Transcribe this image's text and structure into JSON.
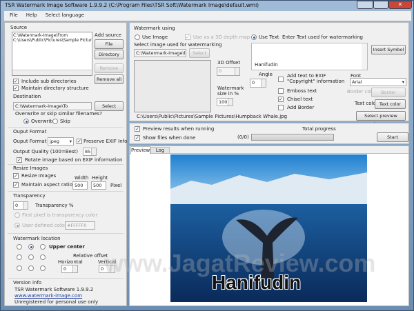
{
  "window": {
    "title": "TSR Watermark Image Software 1.9.9.2 (C:\\Program Files\\TSR Soft\\Watermark Image\\default.wmi)"
  },
  "menu": [
    "File",
    "Help",
    "Select language"
  ],
  "source": {
    "heading": "Source",
    "items": [
      "C:\\Watermark-Image\\From",
      "C:\\Users\\Public\\Pictures\\Sample Pictures"
    ],
    "add_source": "Add source",
    "file": "File",
    "directory": "Directory",
    "remove": "Remove",
    "remove_all": "Remove all",
    "include_sub": "Include sub directories",
    "maintain_dir": "Maintain directory structure"
  },
  "destination": {
    "heading": "Destination",
    "path": "C:\\Watermark-Image\\To",
    "select": "Select",
    "overwrite_q": "Overwrite or skip similar filenames?",
    "overwrite": "Overwrite",
    "skip": "Skip"
  },
  "output": {
    "heading": "Ouput Format",
    "format_label": "Ouput Format",
    "format": "jpeg",
    "preserve_exif": "Preserve EXIF Info",
    "quality_label": "Output Quality (100=Best)",
    "quality": "85",
    "rotate": "Rotate image based on EXIF information"
  },
  "resize": {
    "heading": "Resize Images",
    "resize": "Resize Images",
    "aspect": "Maintain aspect ratio",
    "width_label": "Width",
    "height_label": "Height",
    "width": "500",
    "height": "500",
    "unit": "Pixel"
  },
  "transparency": {
    "heading": "Transparency",
    "value": "0",
    "label": "Transparency %",
    "first_pixel": "First pixel is transparency color",
    "user_color": "User defined color",
    "color": "#FFFFF0"
  },
  "location": {
    "heading": "Watermark location",
    "selected": "Upper center",
    "relative": "Relative offset",
    "horizontal": "Horizontal",
    "vertical": "Vertical",
    "h": "0",
    "v": "0"
  },
  "version": {
    "heading": "Version info",
    "name": "TSR Watermark Software 1.9.9.2",
    "link": "www.watermark-image.com",
    "status": "Unregistered for personal use only"
  },
  "watermark": {
    "heading": "Watermark using",
    "use_image": "Use Image",
    "use_3d": "Use as a 3D depth map",
    "select_image_label": "Select image used for watermarking",
    "image_path": "C:\\Watermark-Image\\lo",
    "select": "Select",
    "offset_label": "3D Offset",
    "offset": "0",
    "size_label": "Watermark size in %",
    "size": "100",
    "preview_path": "C:\\Users\\Public\\Pictures\\Sample Pictures\\Humpback Whale.jpg",
    "use_text": "Use Text",
    "enter_text": "Enter Text used for watermarking",
    "text": "Hanifudin",
    "insert_symbol": "Insert Symbol",
    "angle_label": "Angle",
    "angle": "0",
    "exif_copy": "Add text to EXIF \"Copyright\" information",
    "emboss": "Emboss text",
    "chisel": "Chisel text",
    "add_border": "Add Border",
    "font_label": "Font",
    "font": "Arial",
    "border_color_label": "Border color",
    "border_btn": "Border",
    "text_color_label": "Text color",
    "text_color_btn": "Text color",
    "select_preview": "Select preview image"
  },
  "run": {
    "preview_running": "Preview results when running",
    "show_files": "Show files when done",
    "total_progress": "Total progress",
    "count": "(0/0)",
    "progress": 0,
    "start": "Start"
  },
  "tabs": [
    "Preview",
    "Log"
  ],
  "preview": {
    "overlay_text": "Hanifudin",
    "site_watermark": "www.JagatReview.com"
  }
}
